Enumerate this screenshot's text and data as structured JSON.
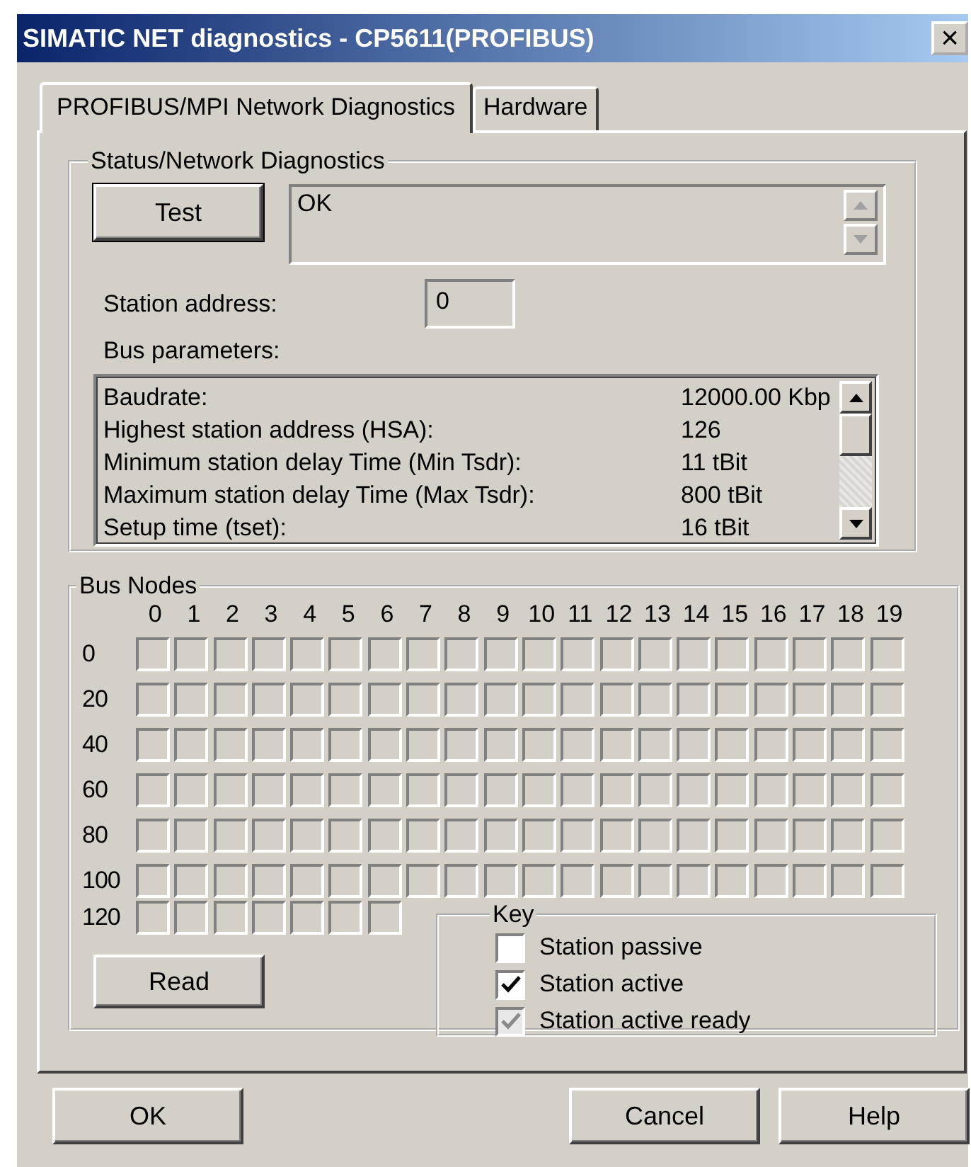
{
  "window": {
    "title": "SIMATIC NET diagnostics - CP5611(PROFIBUS)",
    "close": "×"
  },
  "tabs": [
    {
      "label": "PROFIBUS/MPI Network Diagnostics",
      "selected": true
    },
    {
      "label": "Hardware",
      "selected": false
    }
  ],
  "status_group": {
    "title": "Status/Network Diagnostics",
    "test_button": "Test",
    "output": "OK",
    "station_address_label": "Station address:",
    "station_address": "0",
    "bus_parameters_label": "Bus parameters:",
    "bus_parameters": [
      {
        "name": "Baudrate:",
        "value": "12000.00 Kbp"
      },
      {
        "name": "Highest station address (HSA):",
        "value": "126"
      },
      {
        "name": "Minimum station delay Time (Min Tsdr):",
        "value": "11 tBit"
      },
      {
        "name": "Maximum station delay Time (Max Tsdr):",
        "value": "800 tBit"
      },
      {
        "name": "Setup time (tset):",
        "value": "16 tBit"
      }
    ]
  },
  "bus_nodes": {
    "title": "Bus Nodes",
    "columns": [
      "0",
      "1",
      "2",
      "3",
      "4",
      "5",
      "6",
      "7",
      "8",
      "9",
      "10",
      "11",
      "12",
      "13",
      "14",
      "15",
      "16",
      "17",
      "18",
      "19"
    ],
    "rows": [
      {
        "label": "0",
        "nodes": [
          false,
          false,
          false,
          false,
          false,
          false,
          false,
          false,
          false,
          false,
          false,
          false,
          false,
          false,
          false,
          false,
          false,
          false,
          false,
          false
        ]
      },
      {
        "label": "20",
        "nodes": [
          false,
          false,
          false,
          false,
          false,
          false,
          false,
          false,
          false,
          false,
          false,
          false,
          false,
          false,
          false,
          false,
          false,
          false,
          false,
          false
        ]
      },
      {
        "label": "40",
        "nodes": [
          false,
          false,
          false,
          false,
          false,
          false,
          false,
          false,
          false,
          false,
          false,
          false,
          false,
          false,
          false,
          false,
          false,
          false,
          false,
          false
        ]
      },
      {
        "label": "60",
        "nodes": [
          false,
          false,
          false,
          false,
          false,
          false,
          false,
          false,
          false,
          false,
          false,
          false,
          false,
          false,
          false,
          false,
          false,
          false,
          false,
          false
        ]
      },
      {
        "label": "80",
        "nodes": [
          false,
          false,
          false,
          false,
          false,
          false,
          false,
          false,
          false,
          false,
          false,
          false,
          false,
          false,
          false,
          false,
          false,
          false,
          false,
          false
        ]
      },
      {
        "label": "100",
        "nodes": [
          false,
          false,
          false,
          false,
          false,
          false,
          false,
          false,
          false,
          false,
          false,
          false,
          false,
          false,
          false,
          false,
          false,
          false,
          false,
          false
        ]
      },
      {
        "label": "120",
        "nodes": [
          false,
          false,
          false,
          false,
          false,
          false,
          false
        ]
      }
    ],
    "read_button": "Read",
    "key": {
      "title": "Key",
      "items": [
        {
          "label": "Station passive",
          "checked": false,
          "disabled": false
        },
        {
          "label": "Station active",
          "checked": true,
          "disabled": false
        },
        {
          "label": "Station active ready",
          "checked": true,
          "disabled": true
        }
      ]
    }
  },
  "buttons": [
    {
      "label": "OK",
      "kind": "left"
    },
    {
      "label": "Cancel",
      "kind": "right"
    },
    {
      "label": "Help",
      "kind": "right"
    }
  ]
}
